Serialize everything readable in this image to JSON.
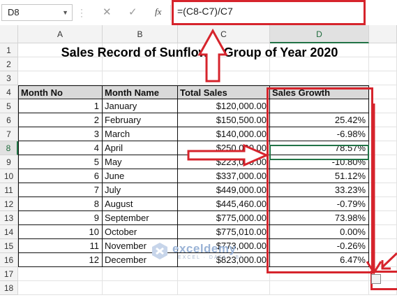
{
  "formula_bar": {
    "name_box": "D8",
    "fx_label": "fx",
    "cancel_glyph": "✕",
    "enter_glyph": "✓",
    "formula": "=(C8-C7)/C7"
  },
  "columns": [
    "A",
    "B",
    "C",
    "D"
  ],
  "row_numbers": [
    "1",
    "2",
    "3",
    "4",
    "5",
    "6",
    "7",
    "8",
    "9",
    "10",
    "11",
    "12",
    "13",
    "14",
    "15",
    "16",
    "17",
    "18"
  ],
  "sheet": {
    "title": "Sales Record of Sunflower Group of Year 2020",
    "headers": [
      "Month No",
      "Month Name",
      "Total Sales",
      "Sales Growth"
    ],
    "rows": [
      {
        "no": "1",
        "month": "January",
        "sales": "$120,000.00",
        "growth": ""
      },
      {
        "no": "2",
        "month": "February",
        "sales": "$150,500.00",
        "growth": "25.42%"
      },
      {
        "no": "3",
        "month": "March",
        "sales": "$140,000.00",
        "growth": "-6.98%"
      },
      {
        "no": "4",
        "month": "April",
        "sales": "$250,000.00",
        "growth": "78.57%"
      },
      {
        "no": "5",
        "month": "May",
        "sales": "$223,000.00",
        "growth": "-10.80%"
      },
      {
        "no": "6",
        "month": "June",
        "sales": "$337,000.00",
        "growth": "51.12%"
      },
      {
        "no": "7",
        "month": "July",
        "sales": "$449,000.00",
        "growth": "33.23%"
      },
      {
        "no": "8",
        "month": "August",
        "sales": "$445,460.00",
        "growth": "-0.79%"
      },
      {
        "no": "9",
        "month": "September",
        "sales": "$775,000.00",
        "growth": "73.98%"
      },
      {
        "no": "10",
        "month": "October",
        "sales": "$775,010.00",
        "growth": "0.00%"
      },
      {
        "no": "11",
        "month": "November",
        "sales": "$773,000.00",
        "growth": "-0.26%"
      },
      {
        "no": "12",
        "month": "December",
        "sales": "$823,000.00",
        "growth": "6.47%"
      }
    ]
  },
  "selection": {
    "active_cell": "D8",
    "active_color": "#217346"
  },
  "annotations": {
    "color": "#d6242c"
  },
  "watermark": {
    "name": "exceldemy",
    "tagline": "EXCEL · DATA · BI"
  }
}
